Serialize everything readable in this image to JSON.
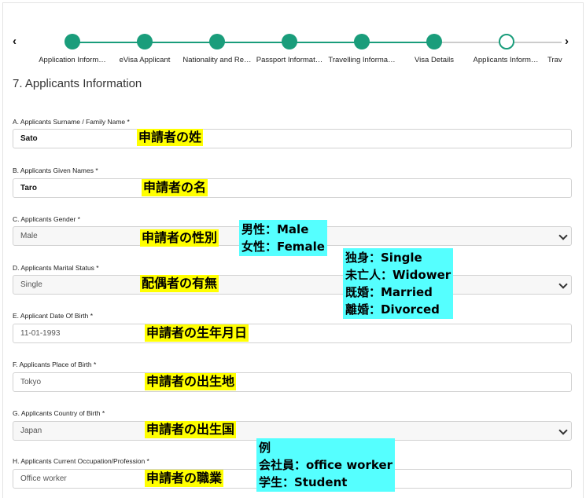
{
  "stepper": {
    "prev_arrow": "‹",
    "next_arrow": "›",
    "steps": [
      {
        "label": "Application Inform…"
      },
      {
        "label": "eVisa Applicant"
      },
      {
        "label": "Nationality and Re…"
      },
      {
        "label": "Passport Informat…"
      },
      {
        "label": "Travelling Informa…"
      },
      {
        "label": "Visa Details"
      },
      {
        "label": "Applicants Inform…"
      },
      {
        "label": "Trav"
      }
    ]
  },
  "section_title": "7. Applicants Information",
  "fields": [
    {
      "label": "A. Applicants Surname / Family Name *",
      "value": "Sato",
      "note": "申請者の姓"
    },
    {
      "label": "B. Applicants Given Names *",
      "value": "Taro",
      "note": "申請者の名"
    },
    {
      "label": "C. Applicants Gender *",
      "value": "Male",
      "note": "申請者の性別"
    },
    {
      "label": "D. Applicants Marital Status *",
      "value": "Single",
      "note": "配偶者の有無"
    },
    {
      "label": "E. Applicant Date Of Birth *",
      "value": "11-01-1993",
      "note": "申請者の生年月日"
    },
    {
      "label": "F. Applicants Place of Birth *",
      "value": "Tokyo",
      "note": "申請者の出生地"
    },
    {
      "label": "G. Applicants Country of Birth *",
      "value": "Japan",
      "note": "申請者の出生国"
    },
    {
      "label": "H. Applicants Current Occupation/Profession *",
      "value": "Office worker",
      "note": "申請者の職業"
    }
  ],
  "callouts": {
    "gender": [
      "男性：Male",
      "女性：Female"
    ],
    "marital": [
      "独身：Single",
      "未亡人：Widower",
      "既婚：Married",
      "離婚：Divorced"
    ],
    "occupation": [
      "例",
      "会社員：office worker",
      "学生：Student"
    ]
  },
  "colors": {
    "accent": "#1a9d7b",
    "note_yellow": "#ffff00",
    "note_cyan": "#55ffff"
  }
}
